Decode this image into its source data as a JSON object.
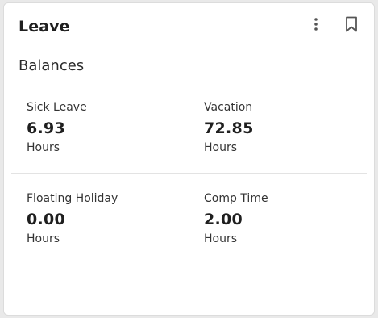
{
  "card": {
    "title": "Leave",
    "section_title": "Balances",
    "actions": {
      "more_icon": "more-vertical-icon",
      "bookmark_icon": "bookmark-icon"
    }
  },
  "balances": [
    {
      "label": "Sick Leave",
      "value": "6.93",
      "unit": "Hours"
    },
    {
      "label": "Vacation",
      "value": "72.85",
      "unit": "Hours"
    },
    {
      "label": "Floating Holiday",
      "value": "0.00",
      "unit": "Hours"
    },
    {
      "label": "Comp Time",
      "value": "2.00",
      "unit": "Hours"
    }
  ],
  "colors": {
    "background": "#e9e9e9",
    "card": "#ffffff",
    "text": "#222222",
    "divider": "#e3e3e3",
    "icon": "#555555"
  }
}
